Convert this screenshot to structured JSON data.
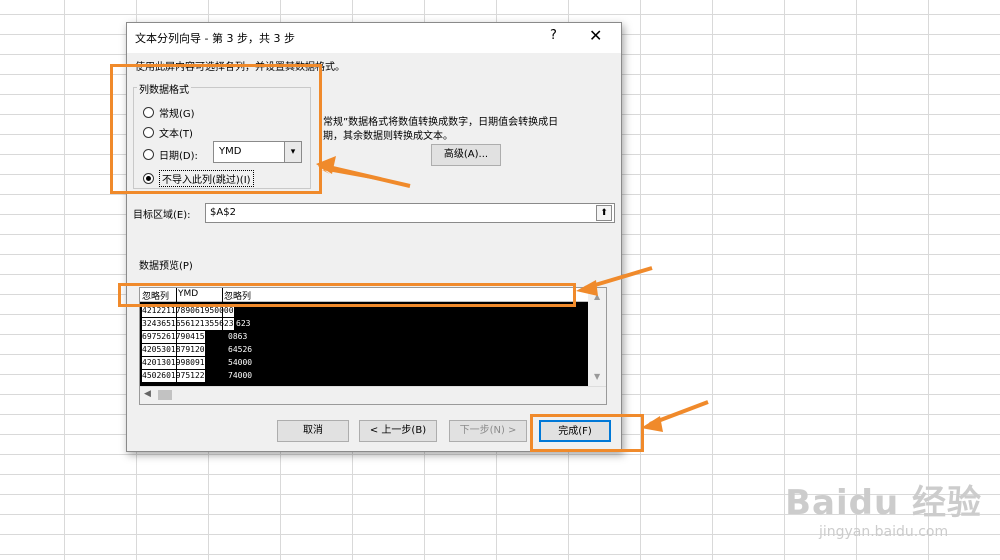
{
  "dialog": {
    "title": "文本分列向导 - 第 3 步，共 3 步",
    "help": "?",
    "close": "✕",
    "instruction": "使用此屏内容可选择各列，并设置其数据格式。"
  },
  "column_format": {
    "legend": "列数据格式",
    "options": [
      {
        "label": "常规(G)",
        "selected": false
      },
      {
        "label": "文本(T)",
        "selected": false
      },
      {
        "label": "日期(D):",
        "selected": false
      },
      {
        "label": "不导入此列(跳过)(I)",
        "selected": true
      }
    ],
    "date_value": "YMD"
  },
  "description": {
    "line1": "常规”数据格式将数值转换成数字，日期值会转换成日",
    "line2": "期，其余数据则转换成文本。"
  },
  "advanced_button": "高级(A)...",
  "destination": {
    "label": "目标区域(E):",
    "value": "$A$2"
  },
  "preview": {
    "label": "数据预览(P)",
    "headers": [
      "忽略列",
      "YMD",
      "忽略列"
    ],
    "rows": [
      "4212211789061950000",
      "3243651656121355623",
      "6975261790415",
      "4205301879120",
      "4201301998091",
      "4502601975122"
    ],
    "row_tails": [
      "000",
      "623",
      "0863",
      "64526",
      "54000",
      "74000"
    ]
  },
  "buttons": {
    "cancel": "取消",
    "back": "< 上一步(B)",
    "next": "下一步(N) >",
    "finish": "完成(F)"
  },
  "watermark": {
    "logo": "Baidu 经验",
    "url": "jingyan.baidu.com"
  },
  "accent_color": "#f08a2b"
}
